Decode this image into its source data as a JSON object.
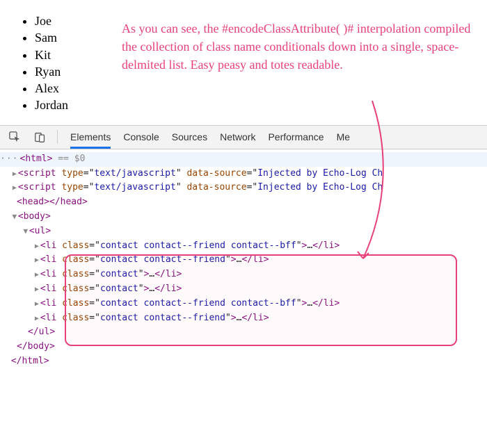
{
  "page": {
    "contacts": [
      "Joe",
      "Sam",
      "Kit",
      "Ryan",
      "Alex",
      "Jordan"
    ]
  },
  "annotation": {
    "text": "As you can see, the #encodeClassAttribute( )# interpolation compiled the collection of class name conditionals down into a single, space-delmited list. Easy peasy and totes readable."
  },
  "devtools": {
    "tabs": {
      "elements": "Elements",
      "console": "Console",
      "sources": "Sources",
      "network": "Network",
      "performance": "Performance",
      "memory_partial": "Me"
    },
    "dom": {
      "html_hint": "== $0",
      "scripts": {
        "type": "text/javascript",
        "data_source_partial": "Injected by Echo-Log Ch"
      },
      "li_class_values": [
        "contact contact--friend contact--bff",
        "contact contact--friend",
        "contact",
        "contact",
        "contact contact--friend contact--bff",
        "contact contact--friend"
      ],
      "attr_class": "class",
      "tags": {
        "html": "html",
        "script": "script",
        "head": "head",
        "body": "body",
        "ul": "ul",
        "li": "li"
      },
      "attrs": {
        "type": "type",
        "data_source": "data-source"
      }
    }
  }
}
